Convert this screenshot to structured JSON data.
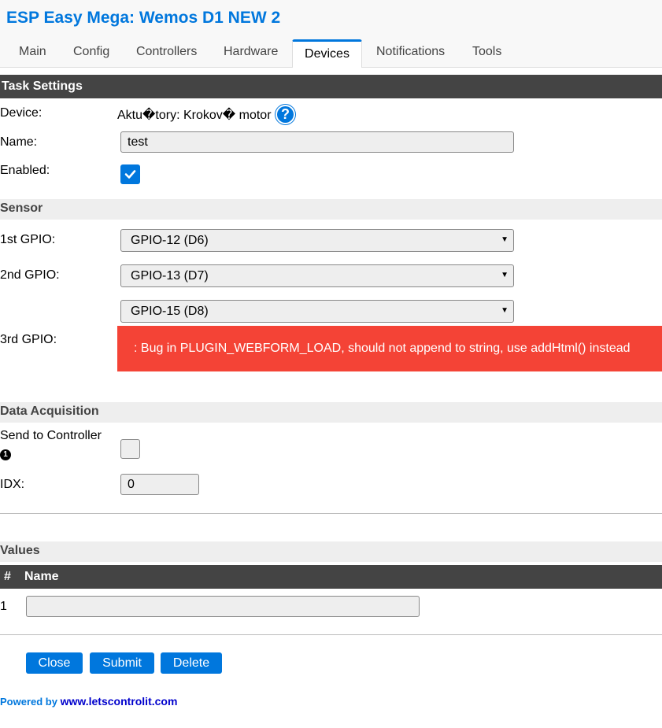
{
  "app": {
    "title": "ESP Easy Mega: Wemos D1 NEW 2"
  },
  "nav": {
    "tabs": [
      {
        "label": "Main"
      },
      {
        "label": "Config"
      },
      {
        "label": "Controllers"
      },
      {
        "label": "Hardware"
      },
      {
        "label": "Devices"
      },
      {
        "label": "Notifications"
      },
      {
        "label": "Tools"
      }
    ],
    "active": "Devices"
  },
  "task_settings": {
    "heading": "Task Settings",
    "device_label": "Device:",
    "device_value": "Aktu�tory: Krokov� motor",
    "name_label": "Name:",
    "name_value": "test",
    "enabled_label": "Enabled:",
    "enabled": true
  },
  "sensor": {
    "heading": "Sensor",
    "gpio1_label": "1st GPIO:",
    "gpio1_value": "GPIO-12 (D6)",
    "gpio2_label": "2nd GPIO:",
    "gpio2_value": "GPIO-13 (D7)",
    "gpio3_label": "3rd GPIO:",
    "gpio3_value": "GPIO-15 (D8)",
    "error_message": ": Bug in PLUGIN_WEBFORM_LOAD, should not append to string, use addHtml() instead"
  },
  "data_acquisition": {
    "heading": "Data Acquisition",
    "send_label": "Send to Controller",
    "send_info_glyph": "❶",
    "send_enabled": false,
    "idx_label": "IDX:",
    "idx_value": "0"
  },
  "values": {
    "heading": "Values",
    "col_num": "#",
    "col_name": "Name",
    "rows": [
      {
        "num": "1",
        "name": ""
      }
    ]
  },
  "buttons": {
    "close": "Close",
    "submit": "Submit",
    "delete": "Delete"
  },
  "footer": {
    "powered_by": "Powered by ",
    "link_text": "www.letscontrolit.com"
  },
  "colors": {
    "accent": "#0077dd",
    "dark_bar": "#444444",
    "error": "#f44336"
  },
  "icons": {
    "help": "question-circle-icon",
    "check": "check-icon",
    "dropdown": "chevron-down-icon",
    "info": "info-icon"
  }
}
